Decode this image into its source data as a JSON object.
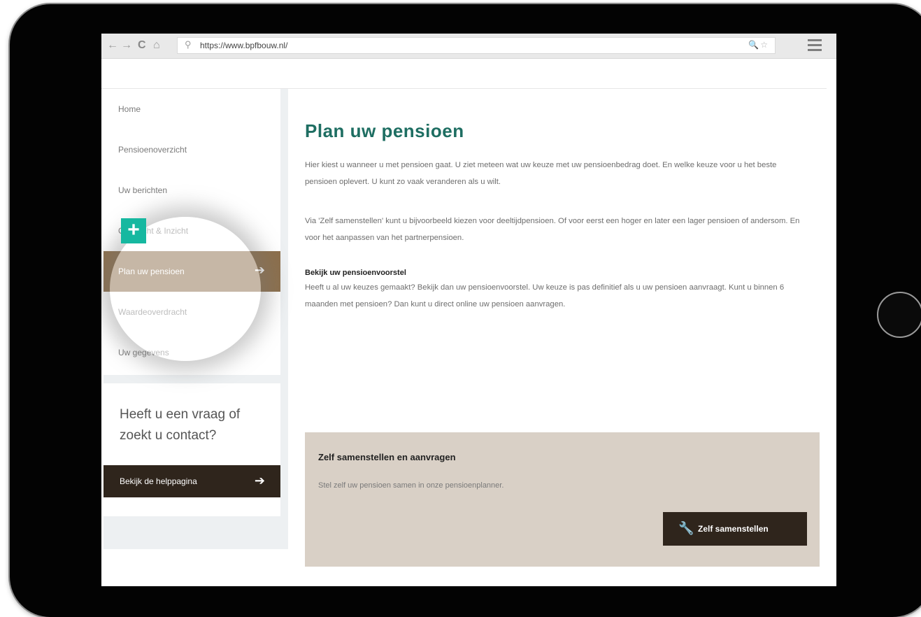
{
  "browser": {
    "back": "←",
    "forward": "→",
    "reload": "C",
    "home": "⌂",
    "url": "https://www.bpfbouw.nl/",
    "url_right": "🔍☆"
  },
  "sidebar": {
    "items": [
      {
        "label": "Home"
      },
      {
        "label": "Pensioenoverzicht"
      },
      {
        "label": "Uw berichten"
      },
      {
        "label": "Overzicht & Inzicht"
      },
      {
        "label": "Plan uw pensioen"
      },
      {
        "label": "Waardeoverdracht"
      },
      {
        "label": "Uw gegevens"
      }
    ],
    "active_arrow": "➔",
    "help_question": "Heeft u een vraag of zoekt u contact?",
    "help_button": "Bekijk de helppagina",
    "help_arrow": "➔"
  },
  "overlay": {
    "plus": "+"
  },
  "main": {
    "title": "Plan uw pensioen",
    "paragraph1": "Hier kiest u wanneer u met pensioen gaat. U ziet meteen wat uw keuze met uw pensioenbedrag doet. En welke keuze voor u het beste pensioen oplevert. U kunt zo vaak veranderen als u wilt.",
    "paragraph2": "Via 'Zelf samenstellen' kunt u bijvoorbeeld kiezen voor deeltijdpensioen. Of voor eerst een hoger en later een lager pensioen of andersom. En voor het aanpassen van het partnerpensioen.",
    "subtitle": "Bekijk uw pensioenvoorstel",
    "paragraph3": "Heeft u al uw keuzes gemaakt? Bekijk dan uw pensioenvoorstel. Uw keuze is pas definitief als u uw pensioen aanvraagt. Kunt u binnen 6 maanden met pensioen? Dan kunt u direct online uw pensioen aanvragen.",
    "zelf": {
      "title": "Zelf samenstellen en aanvragen",
      "description": "Stel zelf uw pensioen samen in onze pensioenplanner.",
      "button": "Zelf samenstellen",
      "button_icon": "🔧"
    }
  },
  "colors": {
    "accent_green": "#1e6e62",
    "active_nav": "#8c6f4c",
    "dark_button": "#2f251c",
    "plus_teal": "#16b8a0",
    "zelf_box": "#d9d0c6"
  }
}
